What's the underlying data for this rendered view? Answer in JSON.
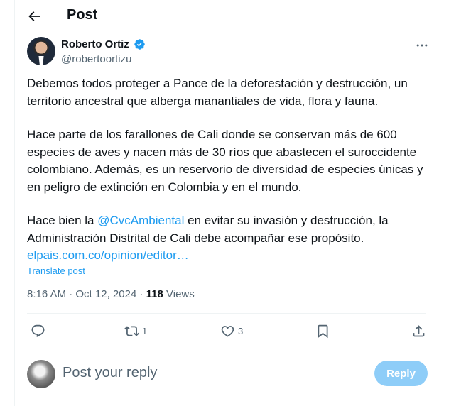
{
  "header": {
    "title": "Post",
    "back_icon": "arrow-left-icon"
  },
  "author": {
    "name": "Roberto Ortiz",
    "handle": "@robertoortizu",
    "verified": true
  },
  "post": {
    "paragraph1": "Debemos todos proteger a Pance de la deforestación y destrucción, un territorio ancestral que alberga manantiales de vida, flora y fauna.",
    "paragraph2": "Hace parte de los farallones de Cali donde se conservan más de 600 especies de aves y nacen más de 30 ríos que abastecen el suroccidente colombiano. Además, es un reservorio de diversidad de especies únicas y en peligro de extinción en Colombia y en el mundo.",
    "paragraph3_before": "Hace bien la ",
    "paragraph3_mention": "@CvcAmbiental",
    "paragraph3_after": " en evitar su invasión y destrucción, la Administración Distrital de Cali debe acompañar ese propósito.",
    "link": "elpais.com.co/opinion/editor…",
    "translate": "Translate post"
  },
  "meta": {
    "time": "8:16 AM",
    "separator": " · ",
    "date": "Oct 12, 2024",
    "views_count": "118",
    "views_label": " Views"
  },
  "actions": {
    "reply_count": "",
    "repost_count": "1",
    "like_count": "3"
  },
  "reply": {
    "placeholder": "Post your reply",
    "button_label": "Reply"
  },
  "colors": {
    "accent": "#1d9bf0",
    "muted": "#536471",
    "reply_button": "#8ecdf8"
  }
}
